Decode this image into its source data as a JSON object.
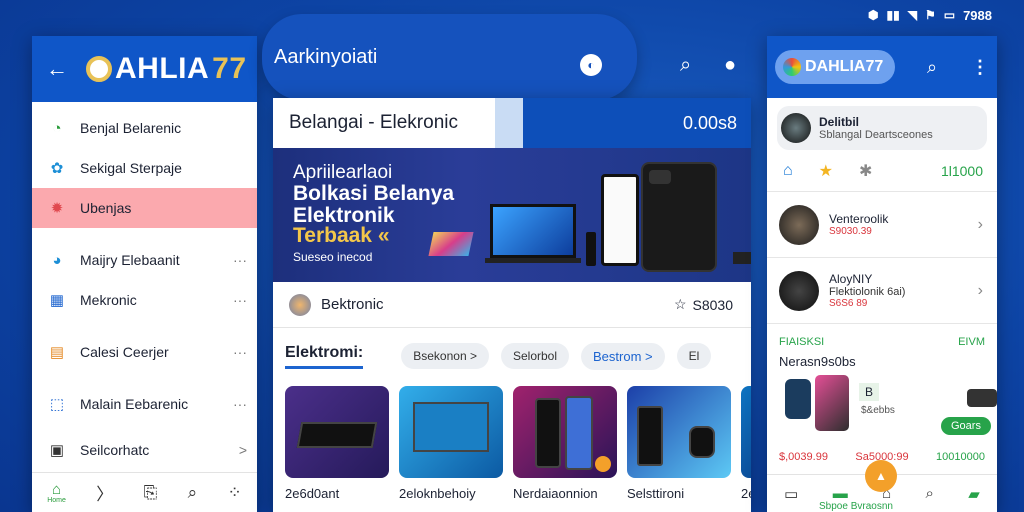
{
  "status_bar": {
    "time": "7988",
    "icons": [
      "shield-icon",
      "signal-icon",
      "wifi-icon",
      "flag-icon",
      "battery-icon"
    ]
  },
  "left_panel": {
    "brand": {
      "name": "AHLIA",
      "suffix": "77",
      "initial": "D"
    },
    "items": [
      {
        "label": "Benjal Belarenic",
        "icon": "clock-icon",
        "trail": ""
      },
      {
        "label": "Sekigal Sterpaje",
        "icon": "gear-icon",
        "trail": ""
      },
      {
        "label": "Ubenjas",
        "icon": "settings-icon",
        "trail": ""
      },
      {
        "label": "Maijry Elebaanit",
        "icon": "circle-icon",
        "trail": "···"
      },
      {
        "label": "Mekronic",
        "icon": "grid-icon",
        "trail": "···"
      },
      {
        "label": "Calesi Ceerjer",
        "icon": "document-icon",
        "trail": "···"
      },
      {
        "label": "Malain Eebarenic",
        "icon": "arrow-icon",
        "trail": "···"
      },
      {
        "label": "Seilcorhatc",
        "icon": "monitor-icon",
        "trail": ">"
      }
    ],
    "bottom_nav": {
      "home_label": "Home"
    }
  },
  "mid_panel": {
    "top_title": "Aarkinyoiati",
    "header_title": "Belangai - Elekronic",
    "header_count": "0.00s8",
    "banner": {
      "line1": "Apriilearlaoi",
      "line2": "Bolkasi Belanya",
      "line3": "Elektronik",
      "line4": "Terbaak «",
      "line5": "Sueseo inecod"
    },
    "store": {
      "name": "Bektronic",
      "rating": "S8030"
    },
    "chips": {
      "tab": "Elektromi:",
      "items": [
        "Bsekonon >",
        "Selorbol",
        "Bestrom >",
        "El"
      ]
    },
    "products": [
      "2e6d0ant",
      "2eloknbehoiy",
      "Nerdaiaonnion",
      "Selsttironi",
      "2e"
    ]
  },
  "right_panel": {
    "brand": "DAHLIA77",
    "profile": {
      "name": "Delitbil",
      "sub": "Sblangal Deartsceones"
    },
    "icon_row_value": "1l1000",
    "items": [
      {
        "title": "Venteroolik",
        "sub": "",
        "price": "S9030.39"
      },
      {
        "title": "AloyNIY",
        "sub": "Flektiolonik 6ai)",
        "price": "S6S6 89"
      }
    ],
    "section_left": "FIAISKSI",
    "section_right": "EIVM",
    "section_title": "Nerasn9s0bs",
    "badge": "B",
    "badge_sub": "$&ebbs",
    "pill": "Goars",
    "prices": [
      "$,0039.99",
      "Sa5000:99",
      "10010000"
    ],
    "bottom_label": "Sbpoe Bvraosnn"
  }
}
